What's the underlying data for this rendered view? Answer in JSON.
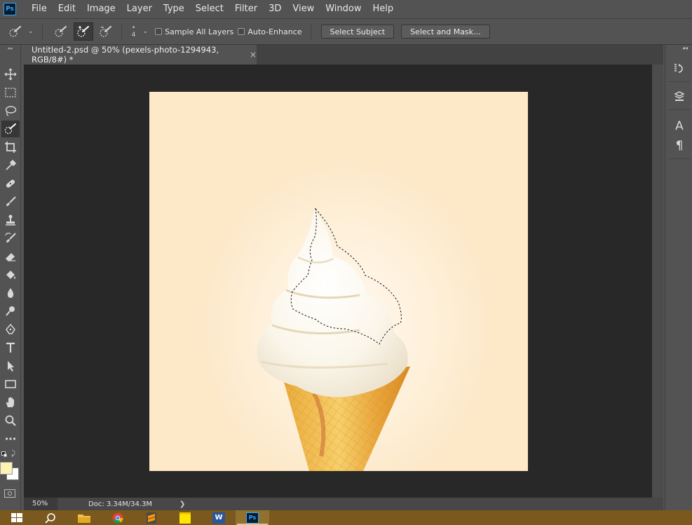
{
  "app": {
    "logo": "Ps"
  },
  "menu": [
    "File",
    "Edit",
    "Image",
    "Layer",
    "Type",
    "Select",
    "Filter",
    "3D",
    "View",
    "Window",
    "Help"
  ],
  "options": {
    "brush_size": "4",
    "sample_all_layers": "Sample All Layers",
    "auto_enhance": "Auto-Enhance",
    "select_subject": "Select Subject",
    "select_and_mask": "Select and Mask..."
  },
  "document_tab": {
    "title": "Untitled-2.psd @ 50% (pexels-photo-1294943, RGB/8#) *",
    "close": "×"
  },
  "toolbar": {
    "collapse": "▸▸",
    "tools": [
      {
        "name": "move-tool",
        "icon": "move-icon"
      },
      {
        "name": "marquee-tool",
        "icon": "marquee-icon"
      },
      {
        "name": "lasso-tool",
        "icon": "lasso-icon"
      },
      {
        "name": "quick-selection-tool",
        "icon": "quick-selection-icon",
        "active": true
      },
      {
        "name": "crop-tool",
        "icon": "crop-icon"
      },
      {
        "name": "eyedropper-tool",
        "icon": "eyedropper-icon"
      },
      {
        "name": "healing-brush-tool",
        "icon": "bandage-icon"
      },
      {
        "name": "brush-tool",
        "icon": "brush-icon"
      },
      {
        "name": "clone-stamp-tool",
        "icon": "stamp-icon"
      },
      {
        "name": "history-brush-tool",
        "icon": "history-brush-icon"
      },
      {
        "name": "eraser-tool",
        "icon": "eraser-icon"
      },
      {
        "name": "paint-bucket-tool",
        "icon": "bucket-icon"
      },
      {
        "name": "blur-tool",
        "icon": "drop-icon"
      },
      {
        "name": "dodge-tool",
        "icon": "dodge-icon"
      },
      {
        "name": "pen-tool",
        "icon": "pen-icon"
      },
      {
        "name": "type-tool",
        "icon": "type-icon"
      },
      {
        "name": "path-selection-tool",
        "icon": "arrow-icon"
      },
      {
        "name": "rectangle-tool",
        "icon": "rectangle-icon"
      },
      {
        "name": "hand-tool",
        "icon": "hand-icon"
      },
      {
        "name": "zoom-tool",
        "icon": "zoom-icon"
      },
      {
        "name": "edit-toolbar",
        "icon": "more-icon"
      }
    ],
    "foreground_color": "#fdf1b6",
    "background_color": "#ffffff"
  },
  "right_panel": {
    "collapse": "◂◂",
    "icons": [
      "history-icon",
      "layers-3d-icon",
      "character-icon",
      "paragraph-icon"
    ],
    "character_glyph": "A",
    "paragraph_glyph": "¶"
  },
  "status": {
    "zoom": "50%",
    "doc": "Doc: 3.34M/34.3M",
    "arrow": "❯"
  },
  "taskbar": {
    "items": [
      "windows-start-icon",
      "search-icon",
      "file-explorer-icon",
      "chrome-icon",
      "sublime-icon",
      "sticky-notes-icon",
      "word-icon",
      "photoshop-icon"
    ],
    "ps_label": "Ps",
    "word_label": "W"
  },
  "colors": {
    "ui_bg": "#535353",
    "canvas_bg": "#282828",
    "taskbar": "#7b581d",
    "accent": "#31a8ff"
  }
}
